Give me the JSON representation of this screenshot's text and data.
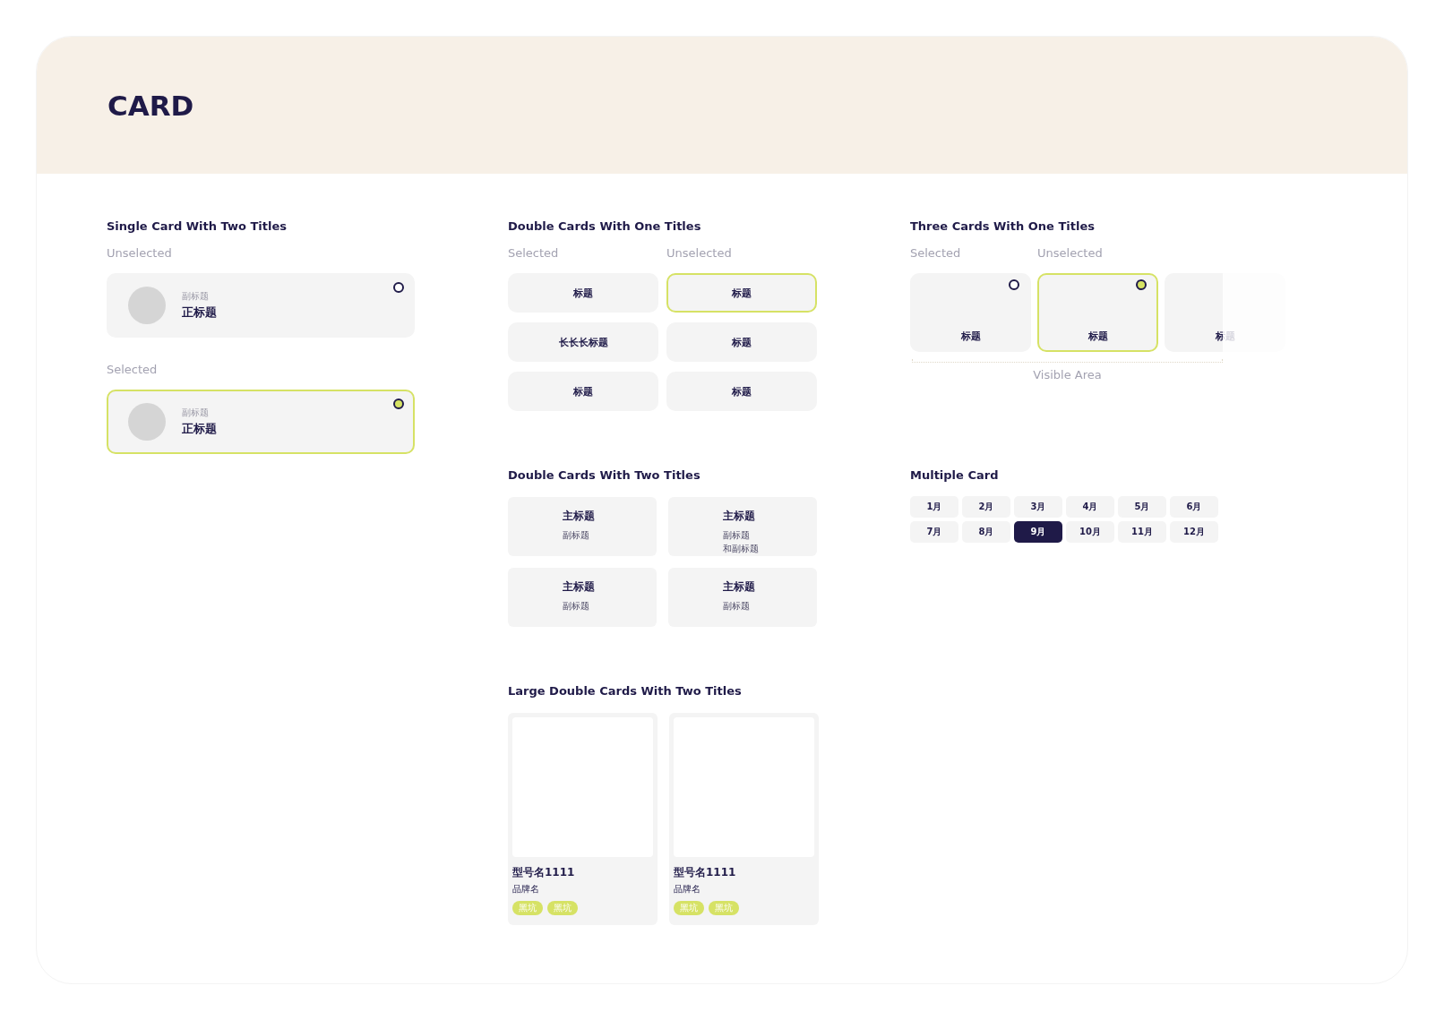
{
  "header": {
    "title": "CARD"
  },
  "single_card": {
    "title": "Single Card With Two Titles",
    "groups": [
      {
        "label": "Unselected",
        "card": {
          "subtitle": "副标题",
          "title": "正标题",
          "selected": false
        }
      },
      {
        "label": "Selected",
        "card": {
          "subtitle": "副标题",
          "title": "正标题",
          "selected": true
        }
      }
    ]
  },
  "double_one": {
    "title": "Double Cards With One Titles",
    "column_labels": [
      "Selected",
      "Unselected"
    ],
    "cards": [
      {
        "title": "标题",
        "selected": false
      },
      {
        "title": "标题",
        "selected": true
      },
      {
        "title": "长长长标题",
        "selected": false
      },
      {
        "title": "标题",
        "selected": false
      },
      {
        "title": "标题",
        "selected": false
      },
      {
        "title": "标题",
        "selected": false
      }
    ]
  },
  "three_cards": {
    "title": "Three Cards With One Titles",
    "column_labels": [
      "Selected",
      "Unselected"
    ],
    "cards": [
      {
        "title": "标题",
        "selected": false,
        "radio": true
      },
      {
        "title": "标题",
        "selected": true,
        "radio": true
      },
      {
        "title": "标题",
        "selected": false,
        "radio": false
      }
    ],
    "visible_area_label": "Visible Area"
  },
  "double_two": {
    "title": "Double Cards With Two Titles",
    "cards": [
      {
        "title": "主标题",
        "subtitle_lines": [
          "副标题"
        ]
      },
      {
        "title": "主标题",
        "subtitle_lines": [
          "副标题",
          "和副标题"
        ]
      },
      {
        "title": "主标题",
        "subtitle_lines": [
          "副标题"
        ]
      },
      {
        "title": "主标题",
        "subtitle_lines": [
          "副标题"
        ]
      }
    ]
  },
  "multiple_card": {
    "title": "Multiple Card",
    "months": [
      {
        "label": "1月",
        "selected": false
      },
      {
        "label": "2月",
        "selected": false
      },
      {
        "label": "3月",
        "selected": false
      },
      {
        "label": "4月",
        "selected": false
      },
      {
        "label": "5月",
        "selected": false
      },
      {
        "label": "6月",
        "selected": false
      },
      {
        "label": "7月",
        "selected": false
      },
      {
        "label": "8月",
        "selected": false
      },
      {
        "label": "9月",
        "selected": true
      },
      {
        "label": "10月",
        "selected": false
      },
      {
        "label": "11月",
        "selected": false
      },
      {
        "label": "12月",
        "selected": false
      }
    ]
  },
  "large_double": {
    "title": "Large Double Cards With Two Titles",
    "cards": [
      {
        "model": "型号名1111",
        "brand": "品牌名",
        "tags": [
          "黑坑",
          "黑坑"
        ]
      },
      {
        "model": "型号名1111",
        "brand": "品牌名",
        "tags": [
          "黑坑",
          "黑坑"
        ]
      }
    ]
  }
}
